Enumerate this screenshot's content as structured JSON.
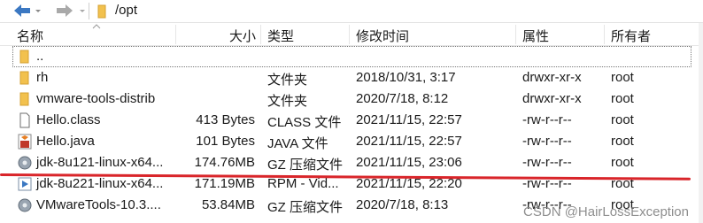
{
  "toolbar": {
    "path": "/opt"
  },
  "columns": {
    "name": "名称",
    "size": "大小",
    "type": "类型",
    "modified": "修改时间",
    "attributes": "属性",
    "owner": "所有者"
  },
  "rows": [
    {
      "name": "..",
      "size": "",
      "type": "",
      "modified": "",
      "attributes": "",
      "owner": ""
    },
    {
      "name": "rh",
      "size": "",
      "type": "文件夹",
      "modified": "2018/10/31, 3:17",
      "attributes": "drwxr-xr-x",
      "owner": "root"
    },
    {
      "name": "vmware-tools-distrib",
      "size": "",
      "type": "文件夹",
      "modified": "2020/7/18, 8:12",
      "attributes": "drwxr-xr-x",
      "owner": "root"
    },
    {
      "name": "Hello.class",
      "size": "413 Bytes",
      "type": "CLASS 文件",
      "modified": "2021/11/15, 22:57",
      "attributes": "-rw-r--r--",
      "owner": "root"
    },
    {
      "name": "Hello.java",
      "size": "101 Bytes",
      "type": "JAVA 文件",
      "modified": "2021/11/15, 22:57",
      "attributes": "-rw-r--r--",
      "owner": "root"
    },
    {
      "name": "jdk-8u121-linux-x64...",
      "size": "174.76MB",
      "type": "GZ 压缩文件",
      "modified": "2021/11/15, 23:06",
      "attributes": "-rw-r--r--",
      "owner": "root"
    },
    {
      "name": "jdk-8u221-linux-x64...",
      "size": "171.19MB",
      "type": "RPM - Vid...",
      "modified": "2021/11/15, 22:20",
      "attributes": "-rw-r--r--",
      "owner": "root"
    },
    {
      "name": "VMwareTools-10.3....",
      "size": "53.84MB",
      "type": "GZ 压缩文件",
      "modified": "2020/7/18, 8:13",
      "attributes": "-rw-r--r--",
      "owner": "root"
    }
  ],
  "watermark": "CSDN @HairLossException",
  "colors": {
    "folder": "#f2c14e",
    "nav_arrow": "#3b78c2",
    "red_underline": "#d9252a"
  }
}
